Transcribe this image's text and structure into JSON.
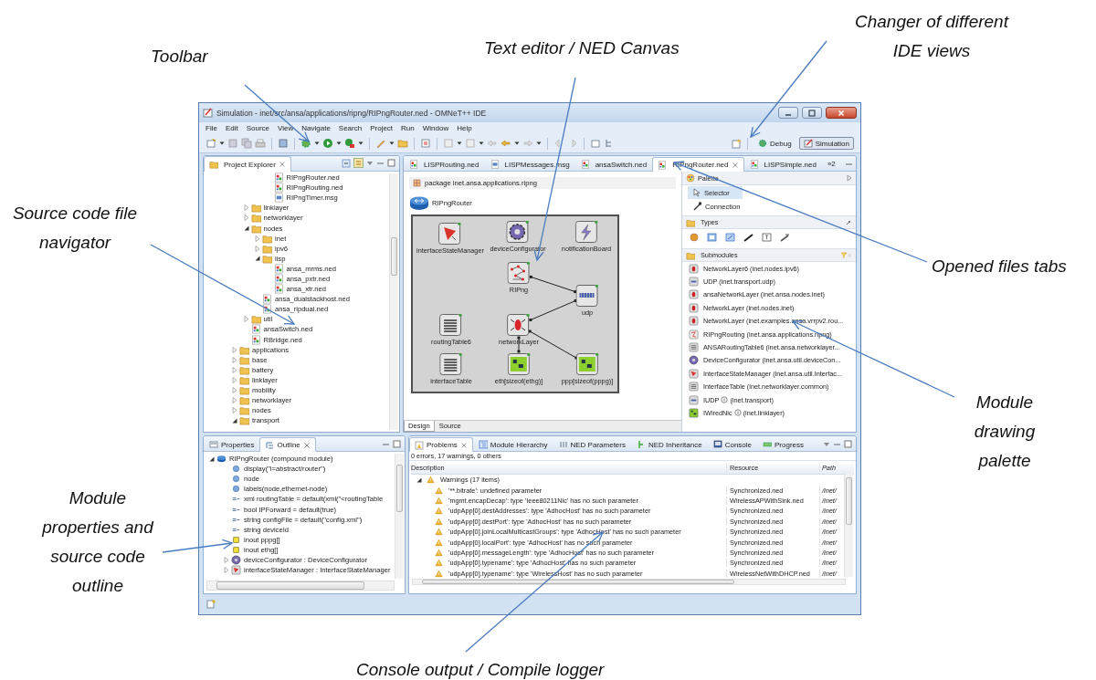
{
  "annotations": [
    {
      "text": "Toolbar"
    },
    {
      "text": "Text editor / NED Canvas"
    },
    {
      "text": "Changer of different IDE views"
    },
    {
      "text": "Source code file navigator"
    },
    {
      "text": "Opened files tabs"
    },
    {
      "text": "Module drawing palette"
    },
    {
      "text": "Module properties and source code outline"
    },
    {
      "text": "Console output / Compile logger"
    }
  ],
  "window": {
    "title": "Simulation - inet/src/ansa/applications/ripng/RIPngRouter.ned - OMNeT++ IDE"
  },
  "menu": [
    "File",
    "Edit",
    "Source",
    "View",
    "Navigate",
    "Search",
    "Project",
    "Run",
    "Window",
    "Help"
  ],
  "perspectives": [
    {
      "label": "Debug",
      "selected": false
    },
    {
      "label": "Simulation",
      "selected": true
    }
  ],
  "project_explorer": {
    "title": "Project Explorer",
    "tree": [
      {
        "children": [
          {
            "children": [
              {
                "children": [
                  {
                    "label": "RIPngRouter.ned",
                    "kind": "ned"
                  },
                  {
                    "label": "RIPngRouting.ned",
                    "kind": "ned"
                  },
                  {
                    "label": "RIPngTimer.msg",
                    "kind": "msg"
                  }
                ]
              }
            ]
          },
          {
            "label": "linklayer",
            "kind": "folder",
            "expanded": false
          },
          {
            "label": "networklayer",
            "kind": "folder",
            "expanded": false
          },
          {
            "label": "nodes",
            "kind": "folder",
            "expanded": true,
            "children": [
              {
                "label": "inet",
                "kind": "folder",
                "expanded": false
              },
              {
                "label": "ipv6",
                "kind": "folder",
                "expanded": false
              },
              {
                "label": "lisp",
                "kind": "folder",
                "expanded": true,
                "children": [
                  {
                    "label": "ansa_mrms.ned",
                    "kind": "ned"
                  },
                  {
                    "label": "ansa_pxtr.ned",
                    "kind": "ned"
                  },
                  {
                    "label": "ansa_xtr.ned",
                    "kind": "ned"
                  }
                ]
              },
              {
                "label": "ansa_dualstackhost.ned",
                "kind": "ned"
              },
              {
                "label": "ansa_ripdual.ned",
                "kind": "ned"
              }
            ]
          },
          {
            "label": "util",
            "kind": "folder",
            "expanded": false
          },
          {
            "label": "ansaSwitch.ned",
            "kind": "ned"
          },
          {
            "label": "RBridge.ned",
            "kind": "ned"
          }
        ]
      },
      {
        "label": "applications",
        "kind": "folder",
        "expanded": false
      },
      {
        "label": "base",
        "kind": "folder",
        "expanded": false
      },
      {
        "label": "battery",
        "kind": "folder",
        "expanded": false
      },
      {
        "label": "linklayer",
        "kind": "folder",
        "expanded": false
      },
      {
        "label": "mobility",
        "kind": "folder",
        "expanded": false
      },
      {
        "label": "networklayer",
        "kind": "folder",
        "expanded": false
      },
      {
        "label": "nodes",
        "kind": "folder",
        "expanded": false
      },
      {
        "label": "transport",
        "kind": "folder",
        "expanded": true
      }
    ]
  },
  "editor": {
    "tabs": [
      {
        "label": "LISPRouting.ned",
        "kind": "ned",
        "selected": false
      },
      {
        "label": "LISPMessages.msg",
        "kind": "msg",
        "selected": false
      },
      {
        "label": "ansaSwitch.ned",
        "kind": "ned",
        "selected": false
      },
      {
        "label": "RIPngRouter.ned",
        "kind": "ned",
        "selected": true
      },
      {
        "label": "LISPSimple.ned",
        "kind": "ned",
        "selected": false
      }
    ],
    "overflow": "»2",
    "package": "package inet.ansa.applications.ripng",
    "module": "RIPngRouter",
    "submodules": [
      {
        "name": "interfaceStateManager",
        "kind": "ism"
      },
      {
        "name": "deviceConfigurator",
        "kind": "gear"
      },
      {
        "name": "notificationBoard",
        "kind": "bolt"
      },
      {
        "name": "RIPng",
        "kind": "graph"
      },
      {
        "name": "udp",
        "kind": "udp"
      },
      {
        "name": "routingTable6",
        "kind": "table"
      },
      {
        "name": "networkLayer",
        "kind": "layer"
      },
      {
        "name": "interfaceTable",
        "kind": "table"
      },
      {
        "name": "eth[sizeof(ethg)]",
        "kind": "nic"
      },
      {
        "name": "ppp[sizeof(pppg)]",
        "kind": "nic"
      }
    ],
    "bottom_tabs": [
      {
        "label": "Design",
        "selected": true
      },
      {
        "label": "Source",
        "selected": false
      }
    ]
  },
  "palette": {
    "title": "Palette",
    "tools": [
      {
        "label": "Selector",
        "kind": "selector",
        "selected": true
      },
      {
        "label": "Connection",
        "kind": "connection",
        "selected": false
      }
    ],
    "types_title": "Types",
    "submodules_title": "Submodules",
    "items": [
      {
        "name": "NetworkLayer6 (inet.nodes.ipv6)",
        "kind": "layer",
        "interface": false
      },
      {
        "name": "UDP (inet.transport.udp)",
        "kind": "udp",
        "interface": false
      },
      {
        "name": "ansaNetworkLayer (inet.ansa.nodes.inet)",
        "kind": "layer",
        "interface": false
      },
      {
        "name": "NetworkLayer (inet.nodes.inet)",
        "kind": "layer",
        "interface": false
      },
      {
        "name": "NetworkLayer (inet.examples.ansa.vrrpv2.rou...",
        "kind": "layer",
        "interface": false
      },
      {
        "name": "RIPngRouting (inet.ansa.applications.ripng)",
        "kind": "graph",
        "interface": false
      },
      {
        "name": "ANSARoutingTable6 (inet.ansa.networklayer...",
        "kind": "table",
        "interface": false
      },
      {
        "name": "DeviceConfigurator (inet.ansa.util.deviceCon...",
        "kind": "gear",
        "interface": false
      },
      {
        "name": "InterfaceStateManager (inet.ansa.util.Interfac...",
        "kind": "ism",
        "interface": false
      },
      {
        "name": "InterfaceTable (inet.networklayer.common)",
        "kind": "table",
        "interface": false
      },
      {
        "name": "IUDP",
        "package": "(inet.transport)",
        "kind": "udp",
        "interface": true
      },
      {
        "name": "IWiredNic",
        "package": "(inet.linklayer)",
        "kind": "nic",
        "interface": true
      }
    ]
  },
  "outline": {
    "tabs": [
      {
        "label": "Properties",
        "selected": false
      },
      {
        "label": "Outline",
        "selected": true
      }
    ],
    "tree": [
      {
        "label": "RIPngRouter (compound module)",
        "kind": "module",
        "expanded": true,
        "children": [
          {
            "label": "display(\"i=abstract/router\")",
            "kind": "property"
          },
          {
            "label": "node",
            "kind": "property"
          },
          {
            "label": "labels(node,ethernet-node)",
            "kind": "property"
          },
          {
            "label": "xml routingTable = default(xml(\"<routingTable",
            "kind": "param"
          },
          {
            "label": "bool IPForward = default(true)",
            "kind": "param"
          },
          {
            "label": "string configFile = default(\"config.xml\")",
            "kind": "param"
          },
          {
            "label": "string deviceId",
            "kind": "param"
          },
          {
            "label": "inout pppg[]",
            "kind": "gate"
          },
          {
            "label": "inout ethg[]",
            "kind": "gate"
          },
          {
            "label": "deviceConfigurator : DeviceConfigurator",
            "kind": "gear",
            "expanded": false
          },
          {
            "label": "interfaceStateManager : InterfaceStateManager",
            "kind": "ism",
            "expanded": false
          }
        ]
      }
    ]
  },
  "problems": {
    "tabs": [
      {
        "label": "Problems",
        "selected": true
      },
      {
        "label": "Module Hierarchy",
        "selected": false
      },
      {
        "label": "NED Parameters",
        "selected": false
      },
      {
        "label": "NED Inheritance",
        "selected": false
      },
      {
        "label": "Console",
        "selected": false
      },
      {
        "label": "Progress",
        "selected": false
      }
    ],
    "summary": "0 errors, 17 warnings, 0 others",
    "columns": [
      "Description",
      "Resource",
      "Path"
    ],
    "group": {
      "label": "Warnings (17 items)",
      "expanded": true
    },
    "rows": [
      {
        "description": "'**.bitrate': undefined parameter",
        "resource": "Synchronized.ned",
        "path": "/inet/"
      },
      {
        "description": "'mgmt.encapDecap': type 'Ieee80211Nic' has no such parameter",
        "resource": "WirelessAPWithSink.ned",
        "path": "/inet/"
      },
      {
        "description": "'udpApp[0].destAddresses': type 'AdhocHost' has no such parameter",
        "resource": "Synchronized.ned",
        "path": "/inet/"
      },
      {
        "description": "'udpApp[0].destPort': type 'AdhocHost' has no such parameter",
        "resource": "Synchronized.ned",
        "path": "/inet/"
      },
      {
        "description": "'udpApp[0].joinLocalMulticastGroups': type 'AdhocHost' has no such parameter",
        "resource": "Synchronized.ned",
        "path": "/inet/"
      },
      {
        "description": "'udpApp[0].localPort': type 'AdhocHost' has no such parameter",
        "resource": "Synchronized.ned",
        "path": "/inet/"
      },
      {
        "description": "'udpApp[0].messageLength': type 'AdhocHost' has no such parameter",
        "resource": "Synchronized.ned",
        "path": "/inet/"
      },
      {
        "description": "'udpApp[0].typename': type 'AdhocHost' has no such parameter",
        "resource": "Synchronized.ned",
        "path": "/inet/"
      },
      {
        "description": "'udpApp[0].typename': type 'WirelessHost' has no such parameter",
        "resource": "WirelessNetWithDHCP.ned",
        "path": "/inet/"
      }
    ]
  }
}
